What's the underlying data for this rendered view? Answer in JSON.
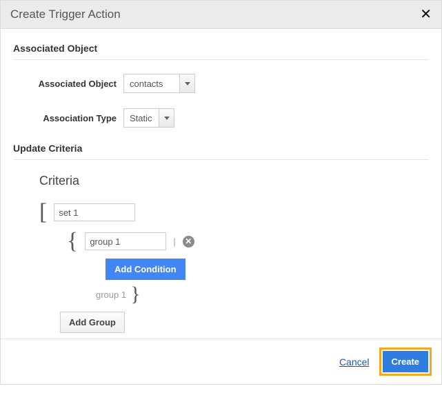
{
  "dialog": {
    "title": "Create Trigger Action",
    "close_glyph": "✕"
  },
  "sections": {
    "associated_object_heading": "Associated Object",
    "update_criteria_heading": "Update Criteria"
  },
  "form": {
    "associated_object": {
      "label": "Associated Object",
      "value": "contacts"
    },
    "association_type": {
      "label": "Association Type",
      "value": "Static"
    }
  },
  "criteria": {
    "title": "Criteria",
    "set_value": "set 1",
    "group_value": "group 1",
    "group_close_label": "group 1",
    "add_condition_label": "Add Condition",
    "add_group_label": "Add Group",
    "remove_glyph": "✕"
  },
  "footer": {
    "cancel": "Cancel",
    "create": "Create"
  }
}
